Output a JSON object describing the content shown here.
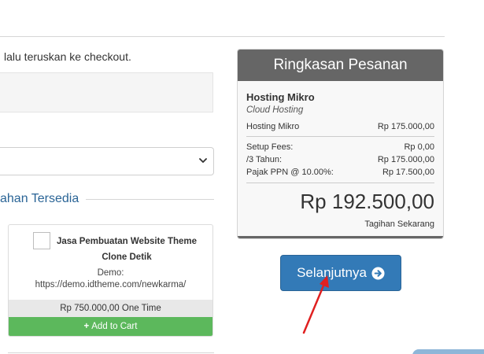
{
  "page": {
    "instruction": "lalu teruskan ke checkout.",
    "addons_heading": "ahan Tersedia"
  },
  "addon": {
    "title": "Jasa Pembuatan Website Theme Clone Detik",
    "demo_label": "Demo:",
    "demo_url": "https://demo.idtheme.com/newkarma/",
    "price": "Rp 750.000,00 One Time",
    "add_to_cart_label": "Add to Cart"
  },
  "summary": {
    "title": "Ringkasan Pesanan",
    "product_name": "Hosting Mikro",
    "product_group": "Cloud Hosting",
    "line_item": {
      "label": "Hosting Mikro",
      "value": "Rp 175.000,00"
    },
    "fees": [
      {
        "label": "Setup Fees:",
        "value": "Rp 0,00"
      },
      {
        "label": "/3 Tahun:",
        "value": "Rp 175.000,00"
      },
      {
        "label": "Pajak PPN @ 10.00%:",
        "value": "Rp 17.500,00"
      }
    ],
    "total": "Rp 192.500,00",
    "total_label": "Tagihan Sekarang"
  },
  "next_button": {
    "label": "Selanjutnya",
    "icon": "arrow-circle-right-icon"
  },
  "colors": {
    "link_blue": "#2a6496",
    "primary": "#337ab7",
    "success": "#5cb85c",
    "summary_header": "#666666",
    "annotation_arrow": "#e02020"
  }
}
